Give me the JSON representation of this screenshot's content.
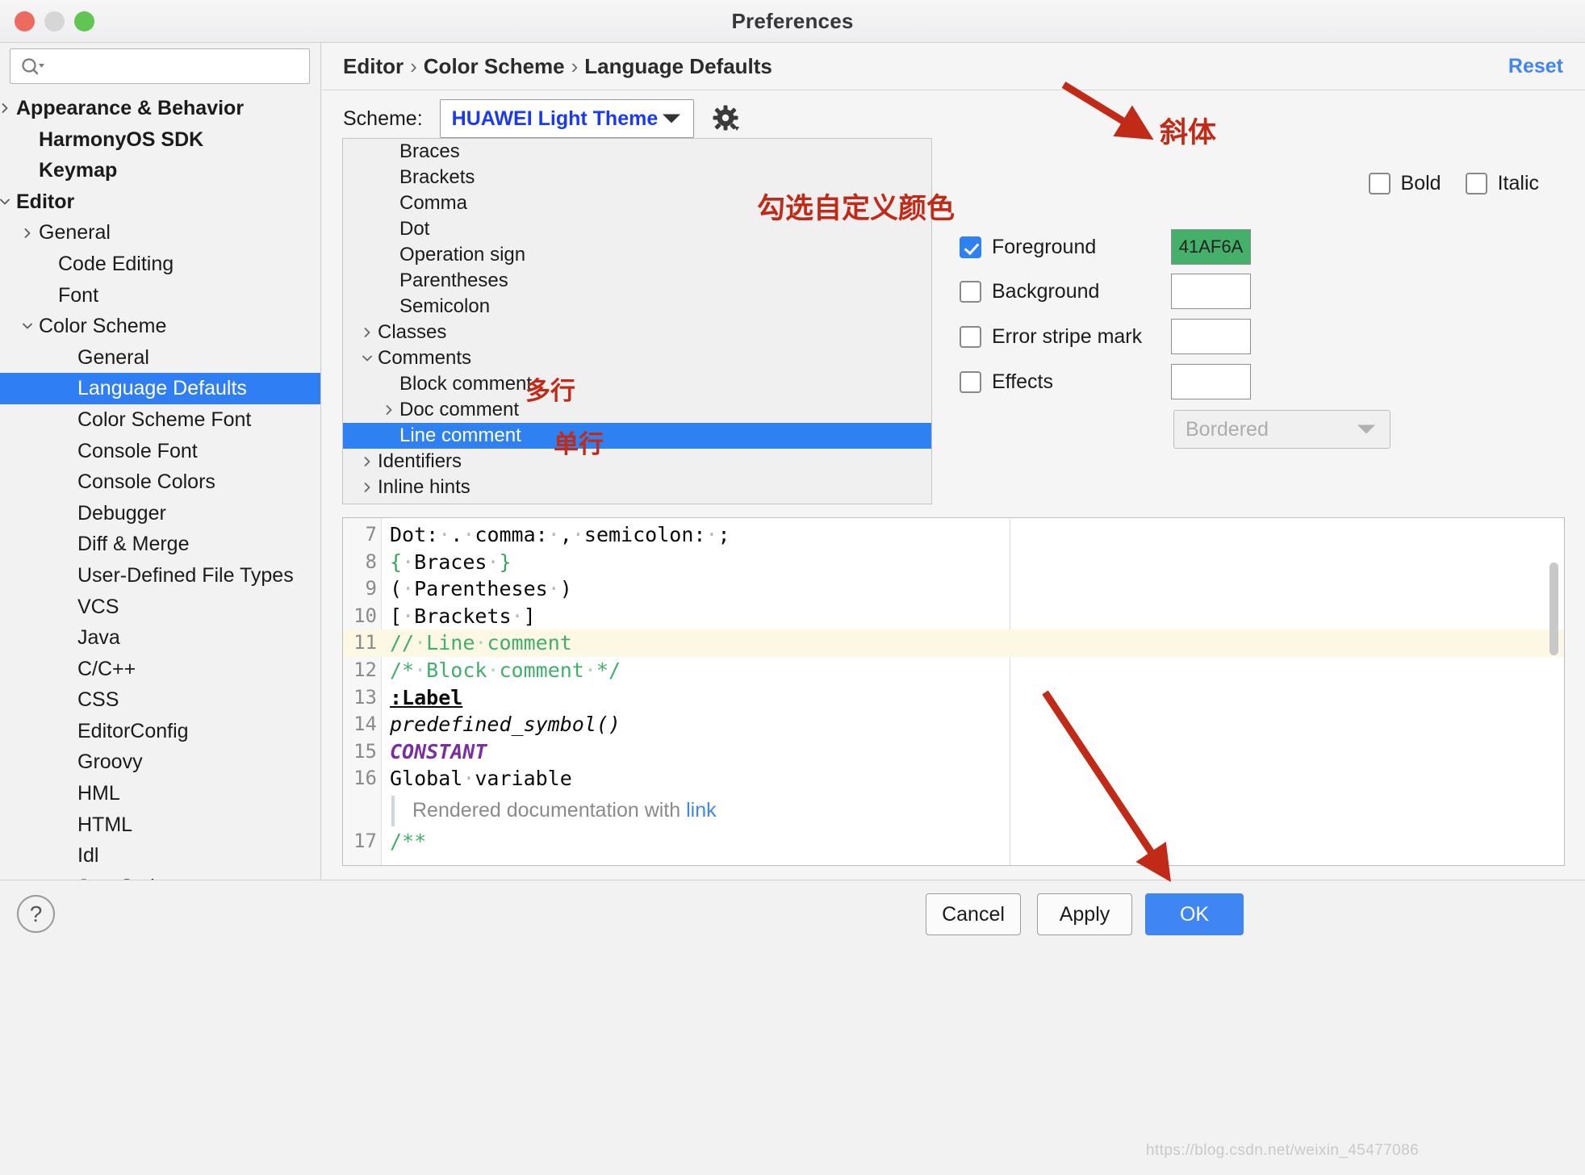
{
  "window": {
    "title": "Preferences",
    "traffic_lights": [
      "close",
      "minimize",
      "zoom"
    ]
  },
  "sidebar": {
    "search": {
      "placeholder": "",
      "value": "",
      "icon": "search-icon"
    },
    "items": [
      {
        "label": "Appearance & Behavior",
        "indent": 20,
        "twisty": "collapsed",
        "bold": true
      },
      {
        "label": "HarmonyOS SDK",
        "indent": 48,
        "twisty": "none",
        "bold": true
      },
      {
        "label": "Keymap",
        "indent": 48,
        "twisty": "none",
        "bold": true
      },
      {
        "label": "Editor",
        "indent": 20,
        "twisty": "expanded",
        "bold": true
      },
      {
        "label": "General",
        "indent": 48,
        "twisty": "collapsed",
        "bold": false
      },
      {
        "label": "Code Editing",
        "indent": 72,
        "twisty": "none",
        "bold": false
      },
      {
        "label": "Font",
        "indent": 72,
        "twisty": "none",
        "bold": false
      },
      {
        "label": "Color Scheme",
        "indent": 48,
        "twisty": "expanded",
        "bold": false
      },
      {
        "label": "General",
        "indent": 96,
        "twisty": "none",
        "bold": false
      },
      {
        "label": "Language Defaults",
        "indent": 96,
        "twisty": "none",
        "bold": false,
        "selected": true
      },
      {
        "label": "Color Scheme Font",
        "indent": 96,
        "twisty": "none",
        "bold": false
      },
      {
        "label": "Console Font",
        "indent": 96,
        "twisty": "none",
        "bold": false
      },
      {
        "label": "Console Colors",
        "indent": 96,
        "twisty": "none",
        "bold": false
      },
      {
        "label": "Debugger",
        "indent": 96,
        "twisty": "none",
        "bold": false
      },
      {
        "label": "Diff & Merge",
        "indent": 96,
        "twisty": "none",
        "bold": false
      },
      {
        "label": "User-Defined File Types",
        "indent": 96,
        "twisty": "none",
        "bold": false
      },
      {
        "label": "VCS",
        "indent": 96,
        "twisty": "none",
        "bold": false
      },
      {
        "label": "Java",
        "indent": 96,
        "twisty": "none",
        "bold": false
      },
      {
        "label": "C/C++",
        "indent": 96,
        "twisty": "none",
        "bold": false
      },
      {
        "label": "CSS",
        "indent": 96,
        "twisty": "none",
        "bold": false
      },
      {
        "label": "EditorConfig",
        "indent": 96,
        "twisty": "none",
        "bold": false
      },
      {
        "label": "Groovy",
        "indent": 96,
        "twisty": "none",
        "bold": false
      },
      {
        "label": "HML",
        "indent": 96,
        "twisty": "none",
        "bold": false
      },
      {
        "label": "HTML",
        "indent": 96,
        "twisty": "none",
        "bold": false
      },
      {
        "label": "Idl",
        "indent": 96,
        "twisty": "none",
        "bold": false
      },
      {
        "label": "JavaScript",
        "indent": 96,
        "twisty": "none",
        "bold": false
      }
    ]
  },
  "breadcrumb": {
    "parts": [
      "Editor",
      "Color Scheme",
      "Language Defaults"
    ],
    "separator": "›"
  },
  "reset": {
    "label": "Reset"
  },
  "scheme": {
    "label": "Scheme:",
    "value": "HUAWEI Light Theme",
    "gear_icon": "gear-icon",
    "chevron_icon": "chevron-down-icon"
  },
  "attribute_tree": [
    {
      "label": "Braces",
      "indent": 70,
      "twisty": "none"
    },
    {
      "label": "Brackets",
      "indent": 70,
      "twisty": "none"
    },
    {
      "label": "Comma",
      "indent": 70,
      "twisty": "none"
    },
    {
      "label": "Dot",
      "indent": 70,
      "twisty": "none"
    },
    {
      "label": "Operation sign",
      "indent": 70,
      "twisty": "none"
    },
    {
      "label": "Parentheses",
      "indent": 70,
      "twisty": "none"
    },
    {
      "label": "Semicolon",
      "indent": 70,
      "twisty": "none"
    },
    {
      "label": "Classes",
      "indent": 43,
      "twisty": "collapsed"
    },
    {
      "label": "Comments",
      "indent": 43,
      "twisty": "expanded"
    },
    {
      "label": "Block comment",
      "indent": 70,
      "twisty": "none"
    },
    {
      "label": "Doc comment",
      "indent": 70,
      "twisty": "collapsed"
    },
    {
      "label": "Line comment",
      "indent": 70,
      "twisty": "none",
      "selected": true
    },
    {
      "label": "Identifiers",
      "indent": 43,
      "twisty": "collapsed"
    },
    {
      "label": "Inline hints",
      "indent": 43,
      "twisty": "collapsed"
    }
  ],
  "options": {
    "bold": {
      "label": "Bold",
      "checked": false
    },
    "italic": {
      "label": "Italic",
      "checked": false
    },
    "foreground": {
      "label": "Foreground",
      "checked": true,
      "color_value": "41AF6A",
      "swatch_hex": "#44b06a"
    },
    "background": {
      "label": "Background",
      "checked": false,
      "color_value": ""
    },
    "error_stripe_mark": {
      "label": "Error stripe mark",
      "checked": false,
      "color_value": ""
    },
    "effects": {
      "label": "Effects",
      "checked": false,
      "color_value": ""
    },
    "effect_type": {
      "value": "Bordered",
      "enabled": false,
      "chevron_icon": "chevron-down-icon"
    }
  },
  "preview": {
    "lines": [
      {
        "no": "7",
        "segments": [
          {
            "t": "Dot:"
          },
          {
            "t": "·",
            "c": "dot"
          },
          {
            "t": "."
          },
          {
            "t": "·",
            "c": "dot"
          },
          {
            "t": "comma:"
          },
          {
            "t": "·",
            "c": "dot"
          },
          {
            "t": ","
          },
          {
            "t": "·",
            "c": "dot"
          },
          {
            "t": "semicolon:"
          },
          {
            "t": "·",
            "c": "dot"
          },
          {
            "t": ";"
          }
        ]
      },
      {
        "no": "8",
        "segments": [
          {
            "t": "{",
            "c": "brace"
          },
          {
            "t": "·",
            "c": "dot"
          },
          {
            "t": "Braces"
          },
          {
            "t": "·",
            "c": "dot"
          },
          {
            "t": "}",
            "c": "brace"
          }
        ]
      },
      {
        "no": "9",
        "segments": [
          {
            "t": "("
          },
          {
            "t": "·",
            "c": "dot"
          },
          {
            "t": "Parentheses"
          },
          {
            "t": "·",
            "c": "dot"
          },
          {
            "t": ")"
          }
        ]
      },
      {
        "no": "10",
        "segments": [
          {
            "t": "["
          },
          {
            "t": "·",
            "c": "dot"
          },
          {
            "t": "Brackets"
          },
          {
            "t": "·",
            "c": "dot"
          },
          {
            "t": "]"
          }
        ]
      },
      {
        "no": "11",
        "highlight": true,
        "segments": [
          {
            "t": "//",
            "c": "comment"
          },
          {
            "t": "·",
            "c": "comment-dot"
          },
          {
            "t": "Line",
            "c": "comment"
          },
          {
            "t": "·",
            "c": "comment-dot"
          },
          {
            "t": "comment",
            "c": "comment"
          }
        ]
      },
      {
        "no": "12",
        "segments": [
          {
            "t": "/*",
            "c": "comment"
          },
          {
            "t": "·",
            "c": "comment-dot"
          },
          {
            "t": "Block",
            "c": "comment"
          },
          {
            "t": "·",
            "c": "comment-dot"
          },
          {
            "t": "comment",
            "c": "comment"
          },
          {
            "t": "·",
            "c": "comment-dot"
          },
          {
            "t": "*/",
            "c": "comment"
          }
        ]
      },
      {
        "no": "13",
        "segments": [
          {
            "t": ":Label",
            "c": "label"
          }
        ]
      },
      {
        "no": "14",
        "segments": [
          {
            "t": "predefined_symbol()",
            "c": "predef"
          }
        ]
      },
      {
        "no": "15",
        "segments": [
          {
            "t": "CONSTANT",
            "c": "constant"
          }
        ]
      },
      {
        "no": "16",
        "segments": [
          {
            "t": "Global"
          },
          {
            "t": "·",
            "c": "dot"
          },
          {
            "t": "variable"
          }
        ]
      }
    ],
    "doc_line": {
      "text": "Rendered documentation with ",
      "link": "link"
    },
    "last_line": {
      "no": "17",
      "text": "/**",
      "class": "comment"
    }
  },
  "footer": {
    "help_label": "?",
    "cancel_label": "Cancel",
    "apply_label": "Apply",
    "ok_label": "OK"
  },
  "annotations": [
    {
      "id": "italic-anno",
      "text": "斜体"
    },
    {
      "id": "custom-color-anno",
      "text": "勾选自定义颜色"
    },
    {
      "id": "multiline-anno",
      "text": "多行"
    },
    {
      "id": "singleline-anno",
      "text": "单行"
    }
  ],
  "watermark": {
    "text": "https://blog.csdn.net/weixin_45477086"
  },
  "colors": {
    "selection_blue": "#2f80f0",
    "link_blue": "#3f86f4",
    "scheme_value_blue": "#1a39f5",
    "annotation_red": "#c22a18",
    "comment_green": "#41AF6A",
    "constant_purple": "#7a2fa0"
  }
}
